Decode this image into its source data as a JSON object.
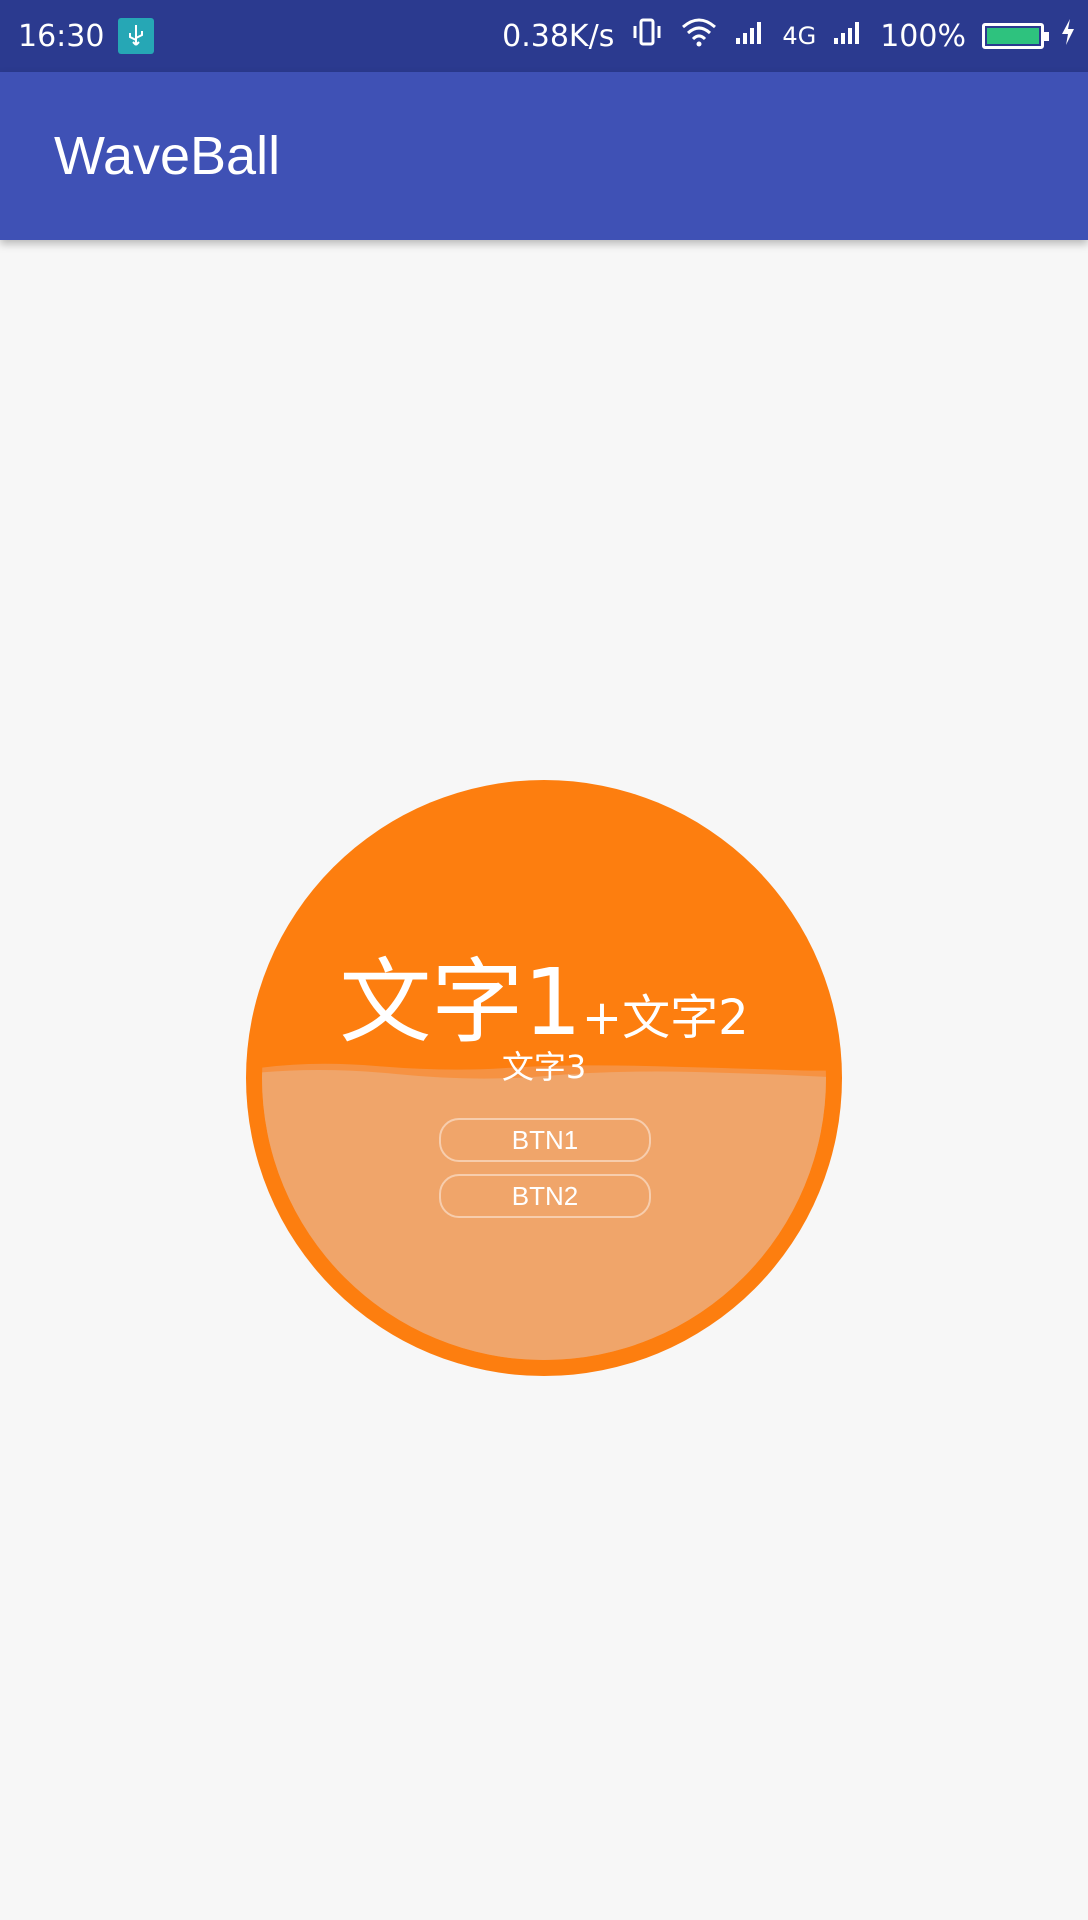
{
  "status_bar": {
    "time": "16:30",
    "net_speed": "0.38K/s",
    "network_type": "4G",
    "battery_percent": "100%",
    "battery_level": 1.0,
    "icons": [
      "usb-icon",
      "vibrate-icon",
      "wifi-icon",
      "signal-icon",
      "signal-icon",
      "battery-icon",
      "charging-icon"
    ]
  },
  "app_bar": {
    "title": "WaveBall"
  },
  "wave_ball": {
    "text1": "文字1",
    "text2": "+文字2",
    "text3": "文字3",
    "button1": "BTN1",
    "button2": "BTN2",
    "colors": {
      "ball": "#fd7e0f",
      "wave": "#f0a56a",
      "primary": "#3f51b5",
      "status": "#2b3a8f"
    }
  }
}
